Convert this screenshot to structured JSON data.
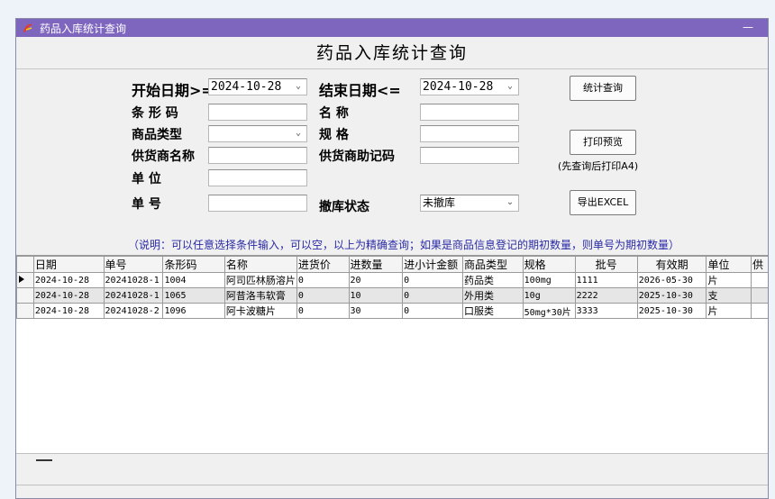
{
  "window": {
    "title": "药品入库统计查询",
    "minimize": "—"
  },
  "header": {
    "title": "药品入库统计查询"
  },
  "form": {
    "start_date_label": "开始日期>=",
    "start_date": "2024-10-28",
    "end_date_label": "结束日期<=",
    "end_date": "2024-10-28",
    "barcode_label": "条 形 码",
    "barcode": "",
    "name_label": "名    称",
    "name": "",
    "category_label": "商品类型",
    "category": "",
    "spec_label": "规      格",
    "spec": "",
    "supplier_label": "供货商名称",
    "supplier": "",
    "supplier_code_label": "供货商助记码",
    "supplier_code": "",
    "unit_label": "单    位",
    "unit": "",
    "order_label": "单    号",
    "order": "",
    "status_label": "撤库状态",
    "status": "未撤库"
  },
  "buttons": {
    "query": "统计查询",
    "print_preview": "打印预览",
    "print_note": "(先查询后打印A4)",
    "export": "导出EXCEL"
  },
  "description": "（说明：可以任意选择条件输入，可以空，以上为精确查询；如果是商品信息登记的期初数量，则单号为期初数量）",
  "table": {
    "columns": [
      "日期",
      "单号",
      "条形码",
      "名称",
      "进货价",
      "进数量",
      "进小计金额",
      "商品类型",
      "规格",
      "批号",
      "有效期",
      "单位",
      "供"
    ],
    "rows": [
      [
        "2024-10-28",
        "20241028-1",
        "1004",
        "阿司匹林肠溶片",
        "0",
        "20",
        "0",
        "药品类",
        "100mg",
        "1111",
        "2026-05-30",
        "片",
        ""
      ],
      [
        "2024-10-28",
        "20241028-1",
        "1065",
        "阿昔洛韦软膏",
        "0",
        "10",
        "0",
        "外用类",
        "10g",
        "2222",
        "2025-10-30",
        "支",
        ""
      ],
      [
        "2024-10-28",
        "20241028-2",
        "1096",
        "阿卡波糖片",
        "0",
        "30",
        "0",
        "口服类",
        "50mg*30片",
        "3333",
        "2025-10-30",
        "片",
        ""
      ]
    ]
  },
  "colors": {
    "titlebar": "#7e66bf",
    "description": "#2a2aa6"
  },
  "icons": {
    "app": "app-logo-icon",
    "dropdown": "chevron-down-icon",
    "current_row": "row-pointer-icon"
  }
}
